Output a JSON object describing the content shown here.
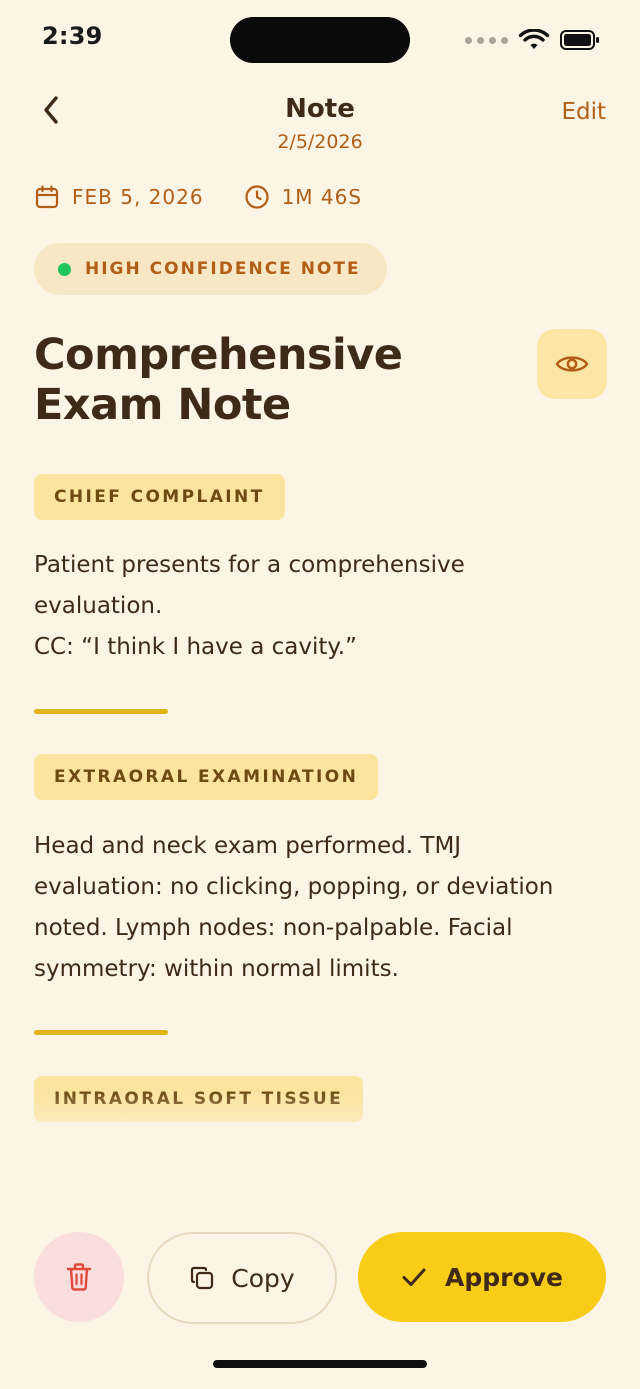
{
  "status_bar": {
    "time": "2:39"
  },
  "nav": {
    "title": "Note",
    "subtitle": "2/5/2026",
    "edit_label": "Edit"
  },
  "meta": {
    "date": "FEB 5, 2026",
    "duration": "1M 46S"
  },
  "confidence": {
    "label": "HIGH CONFIDENCE NOTE",
    "color": "#22C55E"
  },
  "note": {
    "title_line1": "Comprehensive",
    "title_line2": "Exam Note",
    "sections": [
      {
        "tag": "CHIEF COMPLAINT",
        "lines": [
          "Patient presents for a comprehensive",
          "evaluation.",
          "CC: “I think I have a cavity.”"
        ]
      },
      {
        "tag": "EXTRAORAL EXAMINATION",
        "lines": [
          "Head and neck exam performed. TMJ",
          "evaluation: no clicking, popping, or deviation",
          "noted. Lymph nodes: non-palpable. Facial",
          "symmetry: within normal limits."
        ]
      },
      {
        "tag": "INTRAORAL SOFT TISSUE",
        "lines": []
      }
    ]
  },
  "actions": {
    "copy_label": "Copy",
    "approve_label": "Approve"
  },
  "icons": {
    "back": "chevron-left-icon",
    "calendar": "calendar-icon",
    "clock": "clock-icon",
    "eye": "eye-icon",
    "trash": "trash-icon",
    "copy": "copy-icon",
    "check": "check-icon"
  },
  "colors": {
    "background": "#FCF4E4",
    "accent": "#B35E17",
    "primary_button": "#F8CC17",
    "text": "#3F2A17",
    "tag_background": "#FBE49E",
    "divider": "#E2B417",
    "delete_background": "#F9DEDD"
  }
}
